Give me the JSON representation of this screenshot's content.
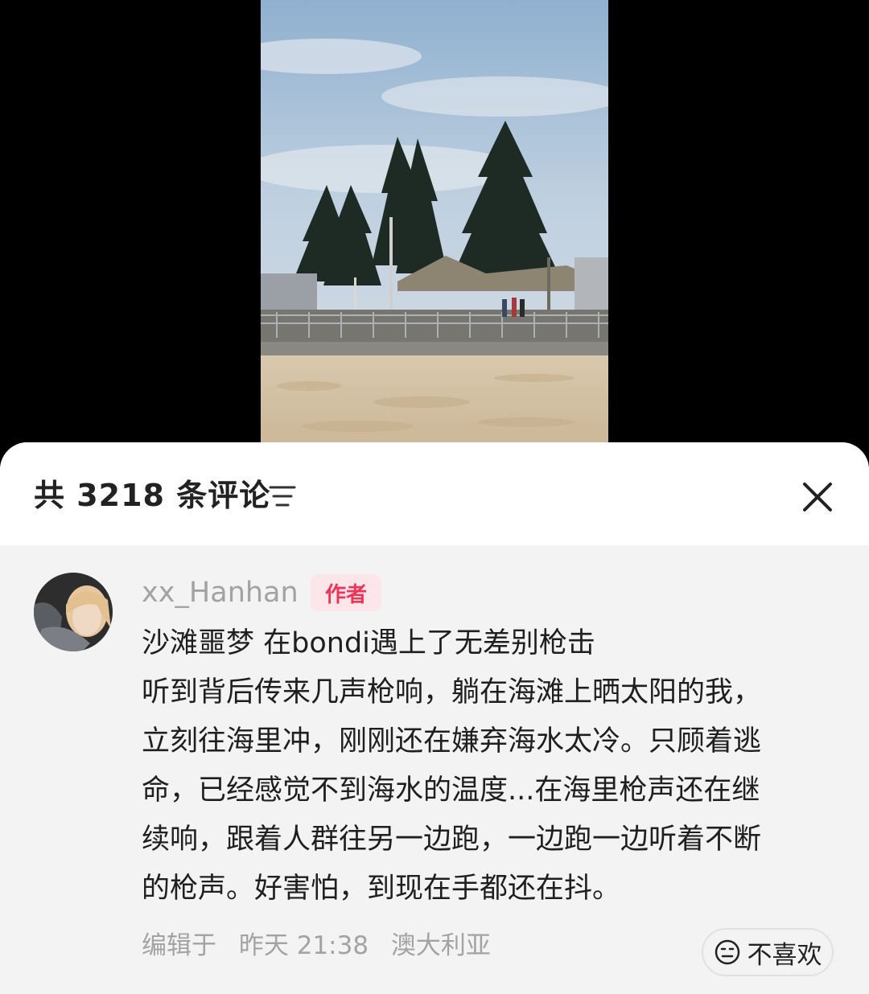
{
  "header": {
    "comment_count_label": "共 3218 条评论"
  },
  "comment": {
    "username": "xx_Hanhan",
    "badge": "作者",
    "lines": [
      "沙滩噩梦 在bondi遇上了无差别枪击",
      "听到背后传来几声枪响，躺在海滩上晒太阳的我，",
      "立刻往海里冲，刚刚还在嫌弃海水太冷。只顾着逃",
      "命，已经感觉不到海水的温度...在海里枪声还在继",
      "续响，跟着人群往另一边跑，一边跑一边听着不断",
      "的枪声。好害怕，到现在手都还在抖。"
    ],
    "meta_edited": "编辑于",
    "meta_time": "昨天 21:38",
    "meta_location": "澳大利亚",
    "dislike_label": "不喜欢"
  },
  "icons": {
    "sort": "sort-icon",
    "close": "close-icon",
    "dislike": "dislike-face-icon"
  },
  "colors": {
    "badge_text": "#ee3457",
    "badge_bg": "#fde6ea",
    "muted_text": "#a3a3a3",
    "comment_bg": "#f3f3f3"
  }
}
